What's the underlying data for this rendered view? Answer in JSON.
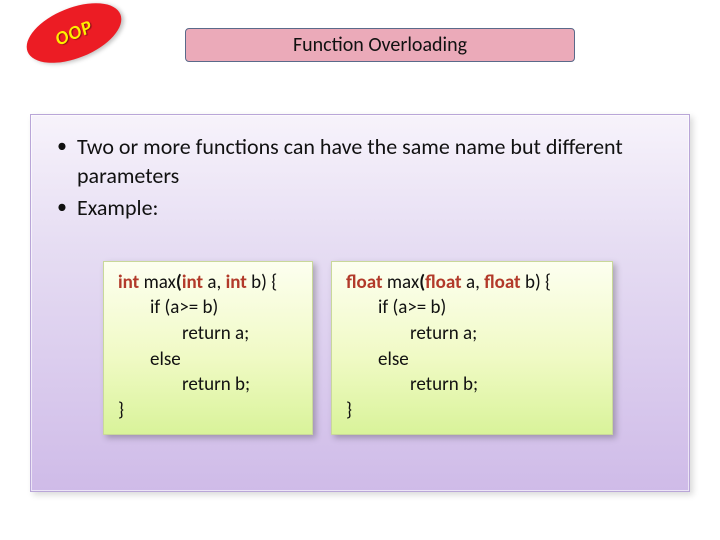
{
  "badge": {
    "text": "OOP"
  },
  "title": "Function Overloading",
  "bullets": [
    "Two or more functions can have the same name but different parameters",
    "Example:"
  ],
  "code": {
    "left": {
      "ret": "int",
      "fn": "max",
      "p1t": "int",
      "p1n": "a",
      "p2t": "int",
      "p2n": "b",
      "l2": "if (a>= b)",
      "l3": "return a;",
      "l4": "else",
      "l5": "return b;",
      "l6": "}"
    },
    "right": {
      "ret": "float",
      "fn": "max",
      "p1t": "float",
      "p1n": "a",
      "p2t": "float",
      "p2n": "b",
      "l2": "if (a>= b)",
      "l3": "return a;",
      "l4": "else",
      "l5": "return b;",
      "l6": "}"
    }
  }
}
